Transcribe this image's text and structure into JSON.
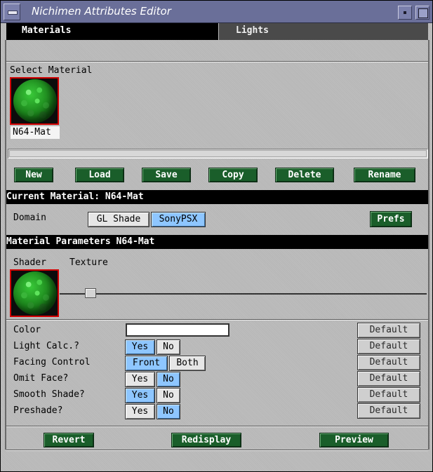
{
  "window": {
    "title": "Nichimen Attributes Editor"
  },
  "tabs": [
    {
      "label": "Materials",
      "active": true
    },
    {
      "label": "Lights",
      "active": false
    }
  ],
  "select_material": {
    "heading": "Select Material",
    "items": [
      {
        "name": "N64-Mat",
        "selected": true
      }
    ]
  },
  "actions": {
    "new": "New",
    "load": "Load",
    "save": "Save",
    "copy": "Copy",
    "delete": "Delete",
    "rename": "Rename"
  },
  "current_material": {
    "header": "Current Material: N64-Mat",
    "domain_label": "Domain",
    "domain_options": [
      {
        "label": "GL Shade",
        "selected": false
      },
      {
        "label": "SonyPSX",
        "selected": true
      }
    ],
    "prefs": "Prefs"
  },
  "params": {
    "header": "Material Parameters N64-Mat",
    "shader_label": "Shader",
    "texture_label": "Texture",
    "rows": [
      {
        "label": "Color",
        "type": "color",
        "value": "#ffffff",
        "default": "Default"
      },
      {
        "label": "Light Calc.?",
        "options": [
          "Yes",
          "No"
        ],
        "selected": "Yes",
        "default": "Default"
      },
      {
        "label": "Facing Control",
        "options": [
          "Front",
          "Both"
        ],
        "selected": "Front",
        "default": "Default"
      },
      {
        "label": "Omit Face?",
        "options": [
          "Yes",
          "No"
        ],
        "selected": "No",
        "default": "Default"
      },
      {
        "label": "Smooth Shade?",
        "options": [
          "Yes",
          "No"
        ],
        "selected": "Yes",
        "default": "Default"
      },
      {
        "label": "Preshade?",
        "options": [
          "Yes",
          "No"
        ],
        "selected": "No",
        "default": "Default"
      }
    ]
  },
  "footer": {
    "revert": "Revert",
    "redisplay": "Redisplay",
    "preview": "Preview"
  },
  "colors": {
    "accent_green": "#1a5e2a",
    "toggle_on": "#8ec6ff",
    "selection_red": "#d00000",
    "titlebar": "#6a6f99"
  }
}
